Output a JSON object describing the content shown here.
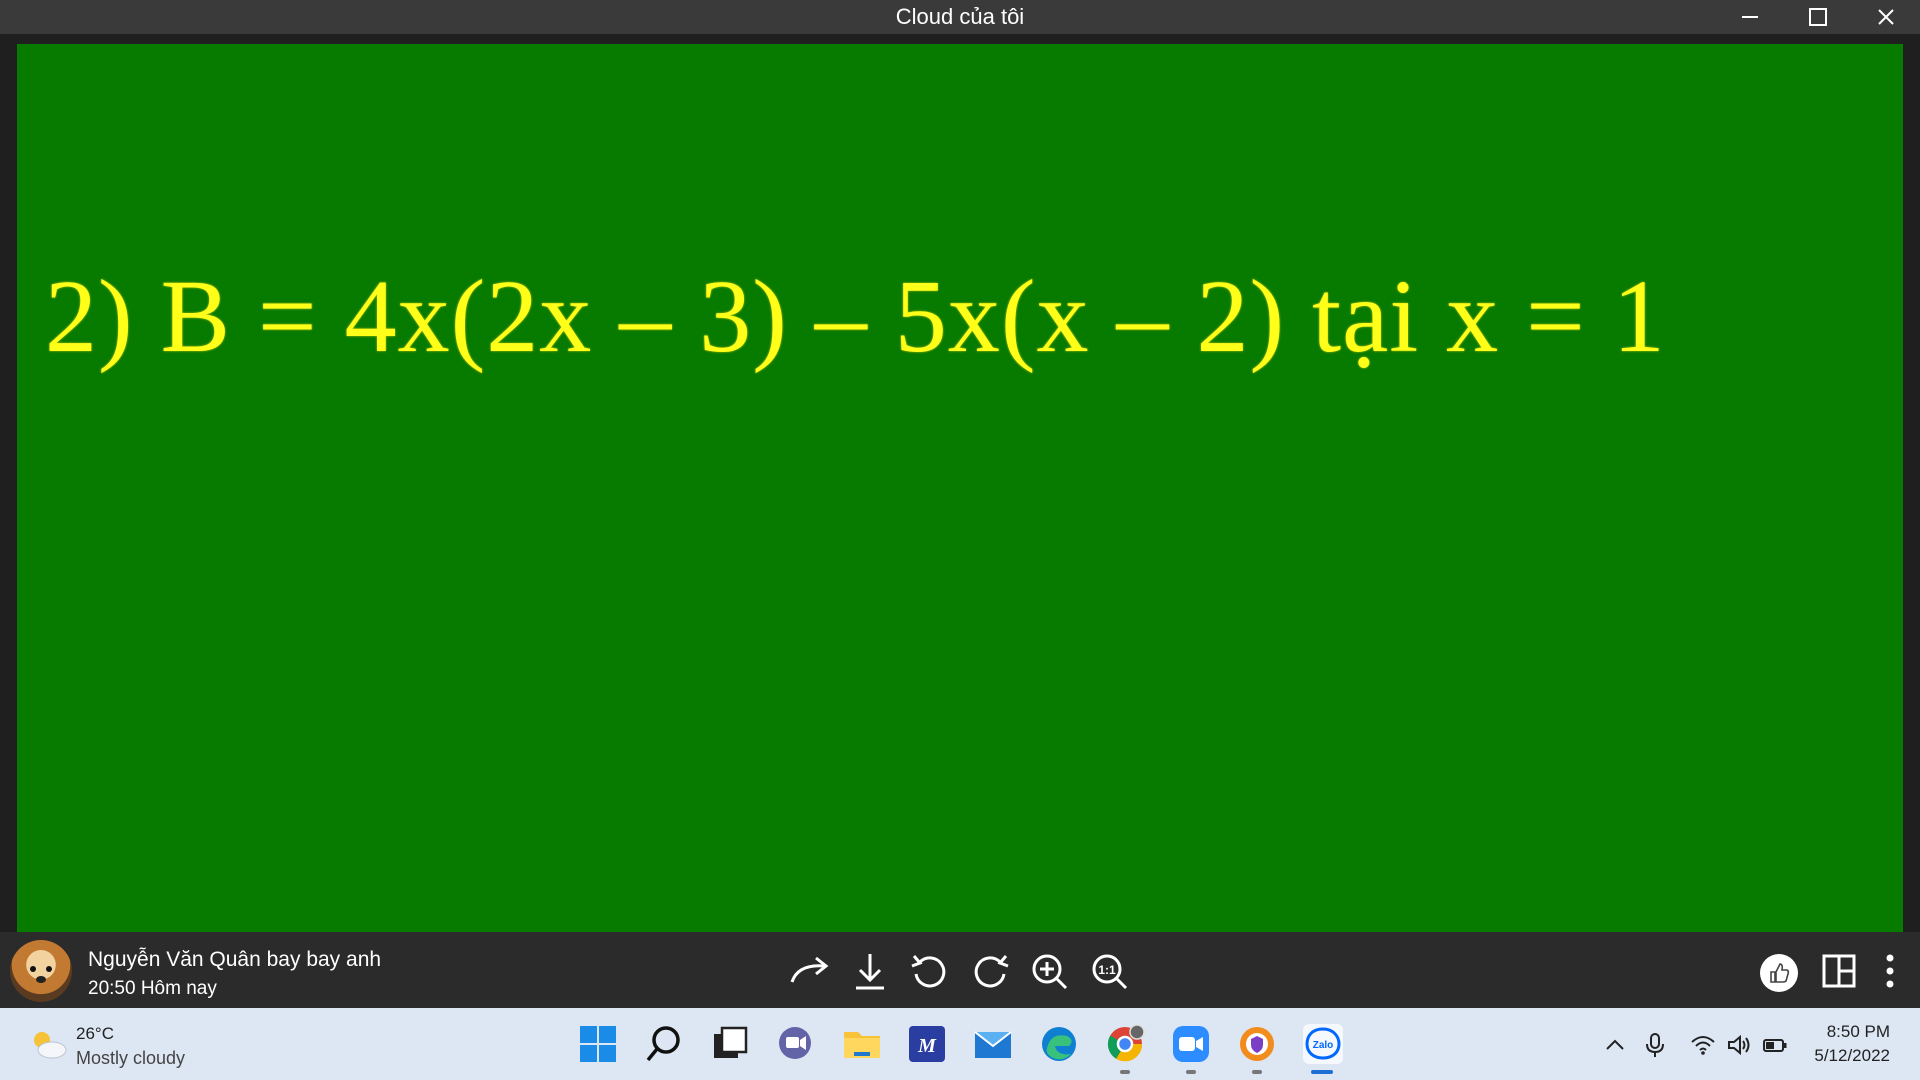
{
  "window": {
    "title": "Cloud của tôi"
  },
  "image": {
    "formula": "2) B = 4x(2x – 3) – 5x(x – 2) tại x = 1",
    "background_color": "#077a00",
    "text_color": "#ffff1a"
  },
  "message": {
    "sender": "Nguyễn Văn Quân bay bay anh",
    "time": "20:50 Hôm nay"
  },
  "toolbar": {
    "icons": [
      "share-icon",
      "download-icon",
      "rotate-left-icon",
      "rotate-right-icon",
      "zoom-in-icon",
      "actual-size-icon"
    ],
    "right_icons": [
      "like-icon",
      "layout-icon",
      "more-icon"
    ]
  },
  "taskbar": {
    "weather": {
      "temp": "26°C",
      "condition": "Mostly cloudy"
    },
    "apps": [
      "start-icon",
      "search-icon",
      "task-view-icon",
      "teams-chat-icon",
      "file-explorer-icon",
      "mathtype-icon",
      "mail-icon",
      "edge-icon",
      "chrome-icon",
      "zoom-icon",
      "vpn-icon",
      "zalo-icon"
    ],
    "clock": {
      "time": "8:50 PM",
      "date": "5/12/2022"
    }
  }
}
